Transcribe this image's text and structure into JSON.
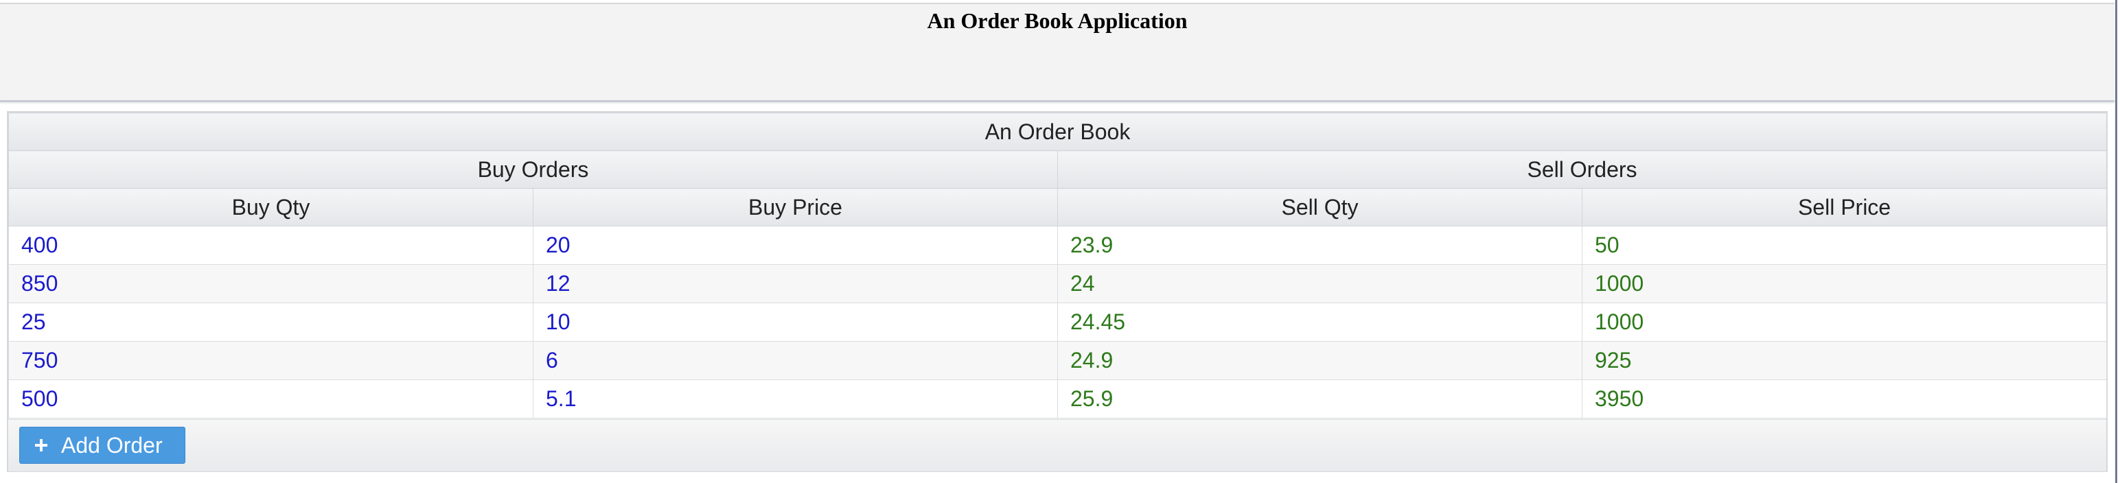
{
  "app": {
    "title": "An Order Book Application"
  },
  "grid": {
    "caption": "An Order Book",
    "groups": {
      "buy": "Buy Orders",
      "sell": "Sell Orders"
    },
    "columns": [
      "Buy Qty",
      "Buy Price",
      "Sell Qty",
      "Sell Price"
    ],
    "rows": [
      [
        "400",
        "20",
        "23.9",
        "50"
      ],
      [
        "850",
        "12",
        "24",
        "1000"
      ],
      [
        "25",
        "10",
        "24.45",
        "1000"
      ],
      [
        "750",
        "6",
        "24.9",
        "925"
      ],
      [
        "500",
        "5.1",
        "25.9",
        "3950"
      ]
    ]
  },
  "toolbar": {
    "add_label": "Add Order",
    "add_icon": "plus-icon"
  },
  "colors": {
    "buy_text": "#1a1acc",
    "sell_text": "#2d7a1a",
    "button": "#4a9ae0"
  }
}
